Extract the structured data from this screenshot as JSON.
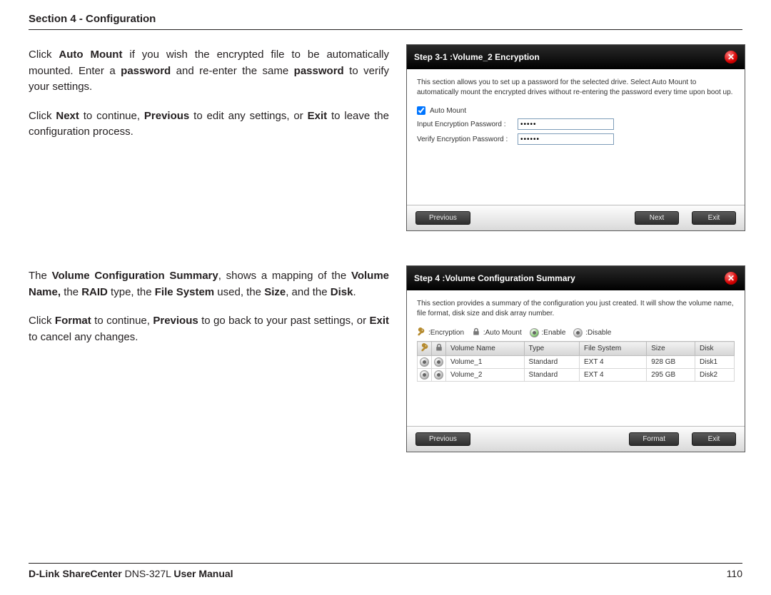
{
  "header": {
    "title": "Section 4 - Configuration"
  },
  "block1": {
    "para1_pre": "Click ",
    "para1_b1": "Auto Mount",
    "para1_mid1": " if you wish the encrypted file to be automatically mounted. Enter a ",
    "para1_b2": "password",
    "para1_mid2": " and re-enter the same ",
    "para1_b3": "password",
    "para1_end": " to verify your settings.",
    "para2_pre": "Click ",
    "para2_b1": "Next",
    "para2_mid1": " to continue, ",
    "para2_b2": "Previous",
    "para2_mid2": " to edit any settings, or ",
    "para2_b3": "Exit",
    "para2_end": " to leave the configuration process."
  },
  "dialog1": {
    "title": "Step 3-1 :Volume_2 Encryption",
    "desc": "This section allows you to set up a password for the selected drive. Select Auto Mount to automatically mount the encrypted drives without re-entering the password every time upon boot up.",
    "automount_label": "Auto Mount",
    "pwd1_label": "Input Encryption Password :",
    "pwd1_value": "•••••",
    "pwd2_label": "Verify Encryption Password :",
    "pwd2_value": "••••••",
    "buttons": {
      "prev": "Previous",
      "next": "Next",
      "exit": "Exit"
    }
  },
  "block2": {
    "para1_pre": "The ",
    "para1_b1": "Volume Configuration Summary",
    "para1_mid1": ", shows a mapping of the ",
    "para1_b2": "Volume Name,",
    "para1_mid2": " the ",
    "para1_b3": "RAID",
    "para1_mid3": " type, the ",
    "para1_b4": "File System",
    "para1_mid4": " used, the ",
    "para1_b5": "Size",
    "para1_mid5": ", and the ",
    "para1_b6": "Disk",
    "para1_end": ".",
    "para2_pre": "Click ",
    "para2_b1": "Format",
    "para2_mid1": " to continue, ",
    "para2_b2": "Previous",
    "para2_mid2": " to go back to your past settings, or ",
    "para2_b3": "Exit",
    "para2_end": " to cancel any changes."
  },
  "dialog2": {
    "title": "Step 4 :Volume Configuration Summary",
    "desc": "This section provides a summary of the configuration you just created. It will show the volume name, file format, disk size and disk array number.",
    "legend": {
      "enc": ":Encryption",
      "am": ":Auto Mount",
      "en": ":Enable",
      "dis": ":Disable"
    },
    "columns": {
      "c1": "",
      "c2": "",
      "c3": "Volume Name",
      "c4": "Type",
      "c5": "File System",
      "c6": "Size",
      "c7": "Disk"
    },
    "rows": [
      {
        "vol": "Volume_1",
        "type": "Standard",
        "fs": "EXT 4",
        "size": "928 GB",
        "disk": "Disk1"
      },
      {
        "vol": "Volume_2",
        "type": "Standard",
        "fs": "EXT 4",
        "size": "295 GB",
        "disk": "Disk2"
      }
    ],
    "buttons": {
      "prev": "Previous",
      "format": "Format",
      "exit": "Exit"
    }
  },
  "footer": {
    "brand_bold": "D-Link ShareCenter",
    "brand_rest": " DNS-327L ",
    "brand_tail": "User Manual",
    "page": "110"
  }
}
